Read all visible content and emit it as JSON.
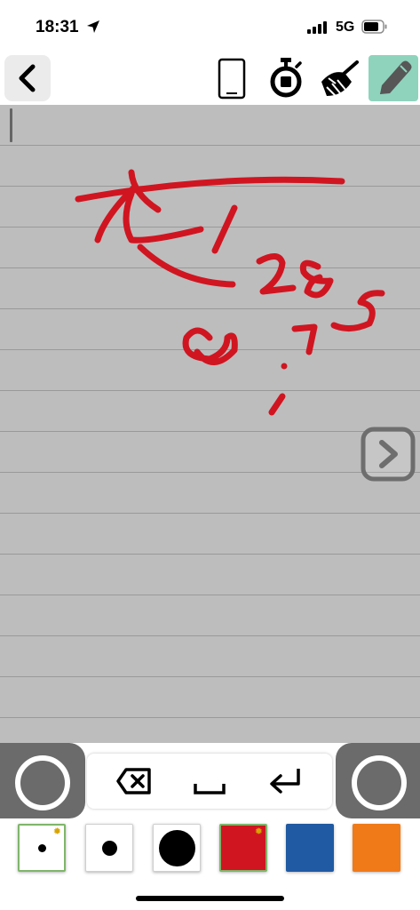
{
  "status_bar": {
    "time": "18:31",
    "network": "5G"
  },
  "toolbar": {
    "back_icon": "chevron-left-icon",
    "tools": [
      "phone-icon",
      "stopwatch-icon",
      "broom-icon",
      "pencil-icon"
    ],
    "active_tool": "pencil"
  },
  "notepad": {
    "paper_color": "#bdbdbd",
    "ink_color": "#d01521",
    "next_icon": "chevron-right-icon"
  },
  "keyboard": {
    "keys": [
      "backspace-icon",
      "space-icon",
      "return-icon"
    ]
  },
  "palette": {
    "swatches": [
      {
        "type": "small-dot",
        "selected": true,
        "has_settings": true
      },
      {
        "type": "medium-dot"
      },
      {
        "type": "large-dot"
      },
      {
        "type": "color",
        "color": "#d01521",
        "has_settings": true
      },
      {
        "type": "color",
        "color": "#1f5aa3"
      },
      {
        "type": "color",
        "color": "#f07a18"
      }
    ]
  }
}
